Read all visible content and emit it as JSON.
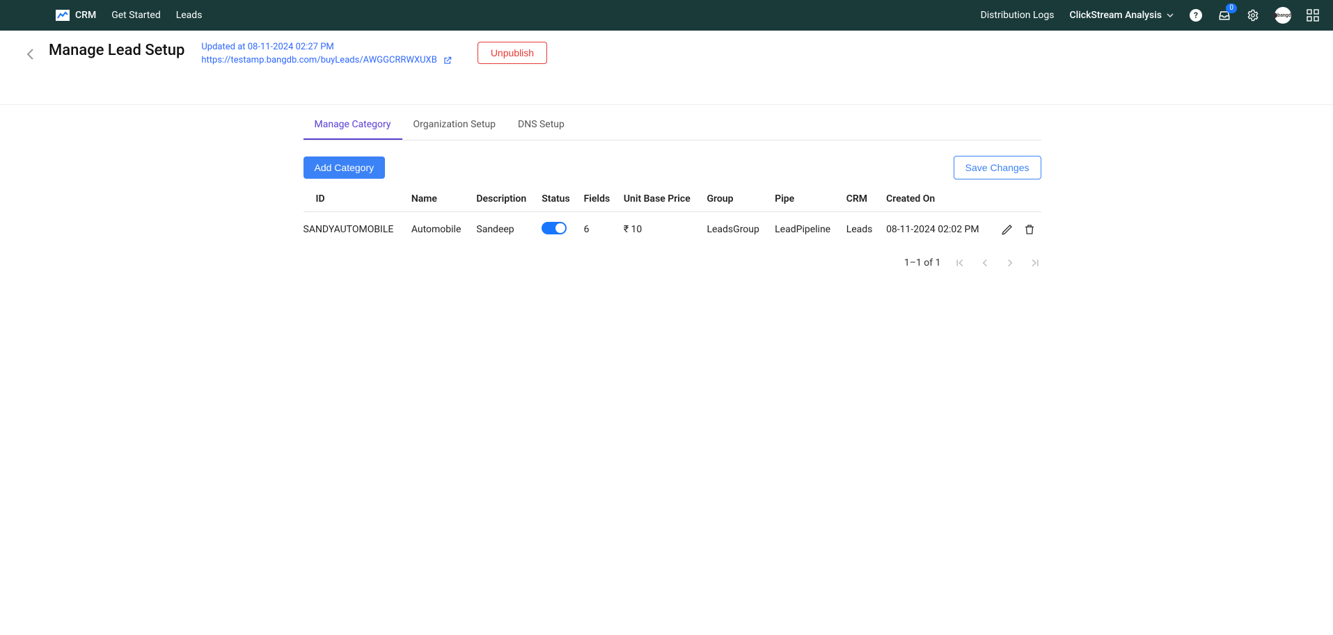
{
  "navbar": {
    "brand": "CRM",
    "links": [
      "Get Started",
      "Leads"
    ],
    "right_links": [
      "Distribution Logs"
    ],
    "dropdown": "ClickStream Analysis",
    "badge": "0"
  },
  "header": {
    "title": "Manage Lead Setup",
    "updated_at": "Updated at 08-11-2024 02:27 PM",
    "url": "https://testamp.bangdb.com/buyLeads/AWGGCRRWXUXB",
    "unpublish": "Unpublish"
  },
  "tabs": [
    "Manage Category",
    "Organization Setup",
    "DNS Setup"
  ],
  "toolbar": {
    "add": "Add Category",
    "save": "Save Changes"
  },
  "table": {
    "headers": [
      "ID",
      "Name",
      "Description",
      "Status",
      "Fields",
      "Unit Base Price",
      "Group",
      "Pipe",
      "CRM",
      "Created On"
    ],
    "rows": [
      {
        "id": "SANDYAUTOMOBILE",
        "name": "Automobile",
        "description": "Sandeep",
        "status": true,
        "fields": "6",
        "price": "₹ 10",
        "group": "LeadsGroup",
        "pipe": "LeadPipeline",
        "crm": "Leads",
        "created_on": "08-11-2024 02:02 PM"
      }
    ]
  },
  "pagination": {
    "label": "1–1 of 1"
  }
}
